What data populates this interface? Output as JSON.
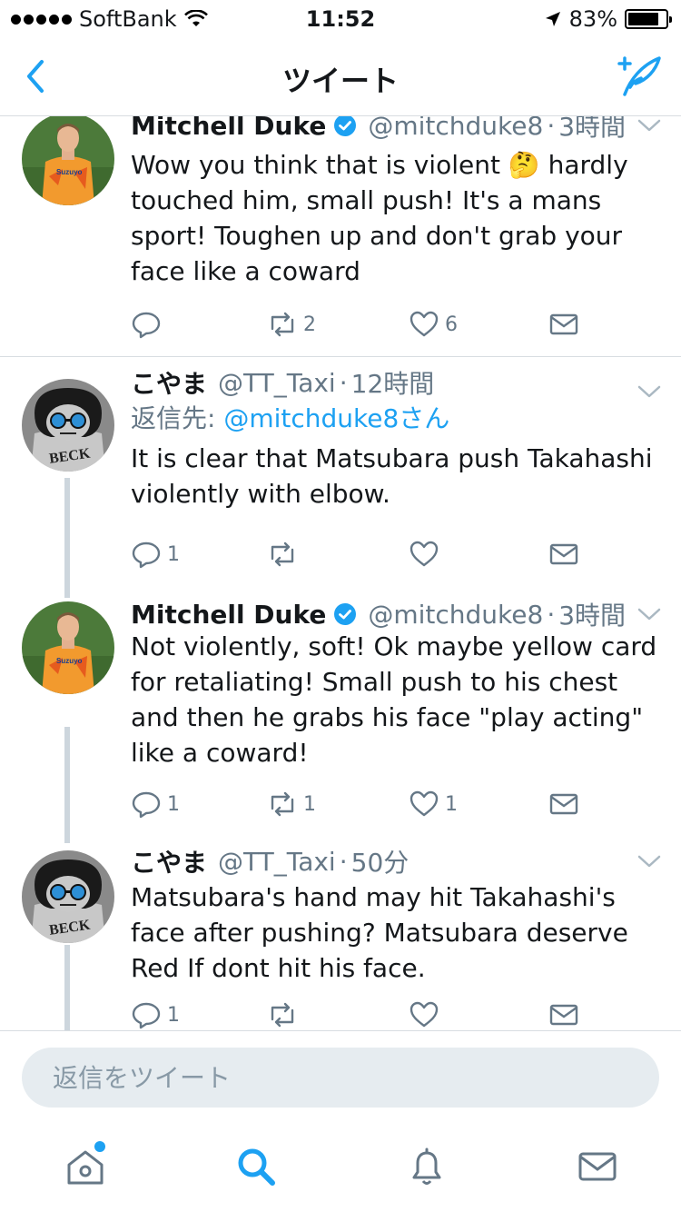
{
  "status_bar": {
    "carrier": "SoftBank",
    "time": "11:52",
    "battery_percent": "83%",
    "battery_level": 0.83
  },
  "nav": {
    "title": "ツイート"
  },
  "tweets": [
    {
      "name": "Mitchell Duke",
      "handle": "@mitchduke8",
      "time": "3時間",
      "text": "Wow you think that is violent 🤔 hardly touched him, small push! It's a mans sport! Toughen up and don't grab your face like a coward",
      "reply_count": "",
      "retweet_count": "2",
      "like_count": "6"
    },
    {
      "name": "こやま",
      "handle": "@TT_Taxi",
      "time": "12時間",
      "reply_prefix": "返信先: ",
      "reply_mention": "@mitchduke8さん",
      "text": "It is clear that Matsubara push Takahashi violently with elbow.",
      "reply_count": "1",
      "retweet_count": "",
      "like_count": ""
    },
    {
      "name": "Mitchell Duke",
      "handle": "@mitchduke8",
      "time": "3時間",
      "text": "Not violently, soft! Ok maybe yellow card for retaliating! Small push to his chest and then he grabs his face \"play acting\" like a coward!",
      "reply_count": "1",
      "retweet_count": "1",
      "like_count": "1"
    },
    {
      "name": "こやま",
      "handle": "@TT_Taxi",
      "time": "50分",
      "text": "Matsubara's hand may hit Takahashi's face after pushing? Matsubara deserve Red If dont hit his face.",
      "reply_count": "1",
      "retweet_count": "",
      "like_count": ""
    }
  ],
  "avatars": {
    "duke_jersey_text": "Suzuyo",
    "koyama_shirt_text": "BECK"
  },
  "reply_box": {
    "placeholder": "返信をツイート"
  },
  "colors": {
    "accent": "#1da1f2",
    "secondary_text": "#657786",
    "thread_line": "#cdd6dd"
  }
}
